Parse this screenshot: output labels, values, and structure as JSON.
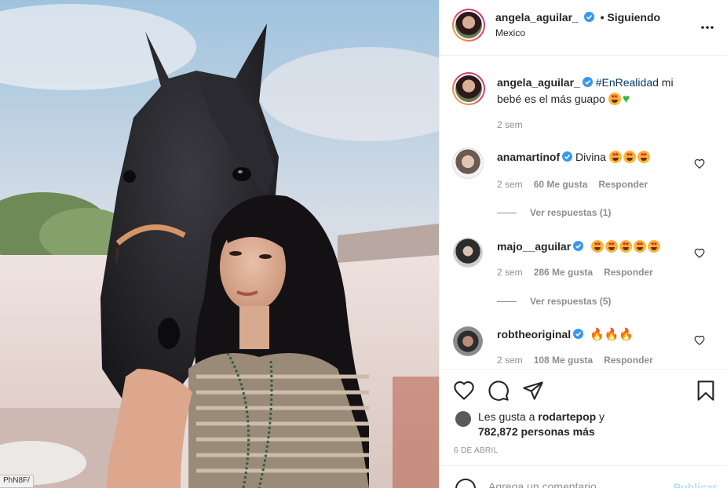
{
  "post": {
    "author": "angela_aguilar_",
    "follow_status": "• Siguiendo",
    "location": "Mexico",
    "caption_hashtag": "#EnRealidad",
    "caption_text": " mi bebé es el más guapo ",
    "caption_time": "2 sem",
    "likes_prefix": "Les gusta a ",
    "likes_user": "rodartepop",
    "likes_suffix": " y",
    "likes_count": "782,872 personas más",
    "date": "6 DE ABRIL",
    "add_comment_placeholder": "Agrega un comentario...",
    "publish_label": "Publicar"
  },
  "comments": [
    {
      "user": "anamartinof",
      "text": "Divina ",
      "emoji_count": 3,
      "time": "2 sem",
      "likes": "60 Me gusta",
      "reply": "Responder",
      "view_replies": "Ver respuestas (1)"
    },
    {
      "user": "majo__aguilar",
      "text": "",
      "emoji_count": 5,
      "time": "2 sem",
      "likes": "286 Me gusta",
      "reply": "Responder",
      "view_replies": "Ver respuestas (5)"
    },
    {
      "user": "robtheoriginal",
      "text": "🔥🔥🔥",
      "emoji_count": 0,
      "time": "2 sem",
      "likes": "108 Me gusta",
      "reply": "Responder"
    }
  ],
  "url_stub": "PhN8F/",
  "colors": {
    "verified": "#3897f0",
    "hashtag": "#00376b",
    "muted": "#8e8e8e",
    "publish_disabled": "#b2dffc"
  },
  "icons": [
    "more-icon",
    "heart-icon",
    "comment-icon",
    "share-icon",
    "bookmark-icon",
    "smile-icon",
    "verified-badge-icon"
  ]
}
